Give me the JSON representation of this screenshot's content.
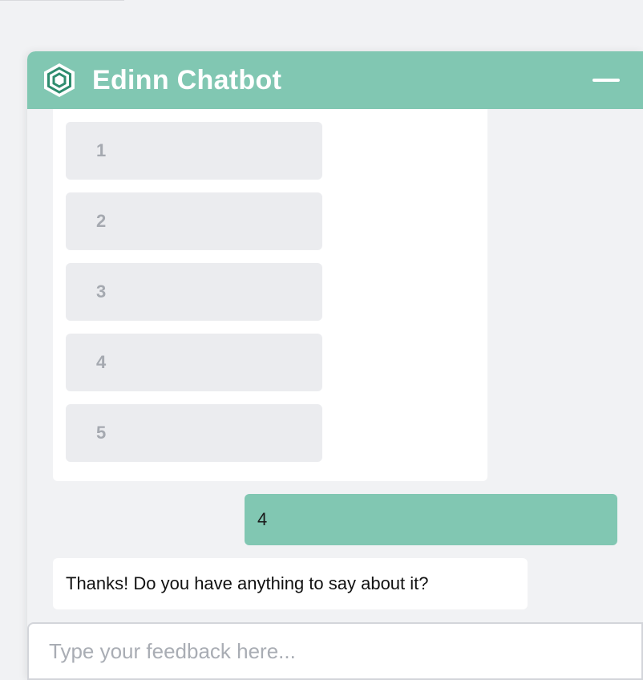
{
  "header": {
    "title": "Edinn Chatbot",
    "logo_icon": "hexagon-logo-icon",
    "minimize_icon": "minimize-icon"
  },
  "options": [
    {
      "label": "1"
    },
    {
      "label": "2"
    },
    {
      "label": "3"
    },
    {
      "label": "4"
    },
    {
      "label": "5"
    }
  ],
  "messages": {
    "user_reply": "4",
    "bot_followup": "Thanks! Do you have anything to say about it?"
  },
  "input": {
    "value": "",
    "placeholder": "Type your feedback here..."
  },
  "colors": {
    "accent": "#81c7b2",
    "background": "#f1f2f4",
    "option_background": "#ebecef",
    "option_text": "#a5a9b0",
    "logo_stroke": "#2e8c6e"
  }
}
